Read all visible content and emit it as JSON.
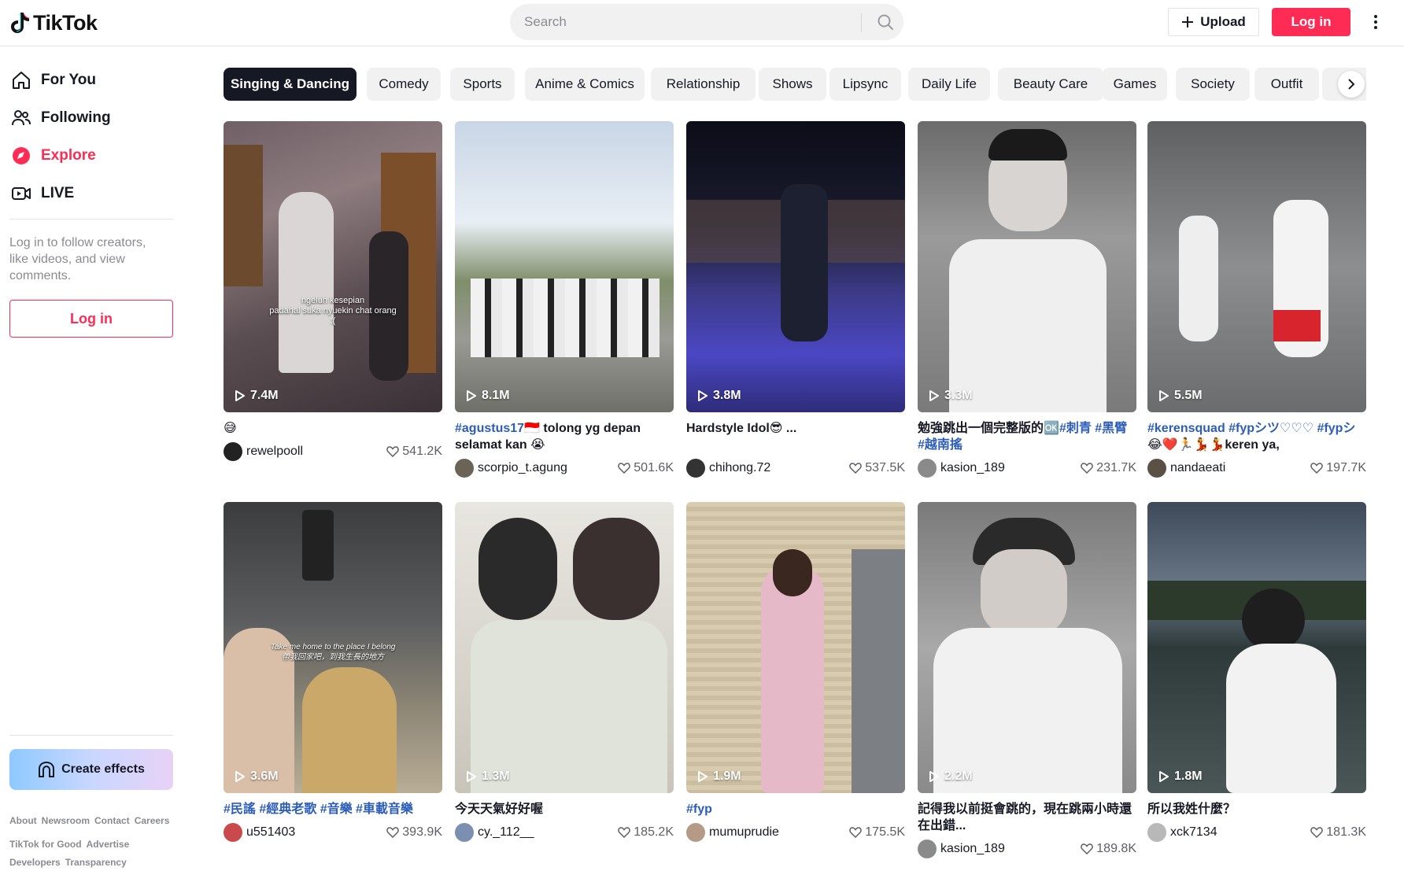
{
  "header": {
    "logo_text": "TikTok",
    "search_placeholder": "Search",
    "upload_label": "Upload",
    "login_label": "Log in"
  },
  "sidebar": {
    "items": [
      {
        "label": "For You",
        "icon": "home-icon"
      },
      {
        "label": "Following",
        "icon": "following-icon"
      },
      {
        "label": "Explore",
        "icon": "compass-icon",
        "active": true
      },
      {
        "label": "LIVE",
        "icon": "live-icon"
      }
    ],
    "note": "Log in to follow creators, like videos, and view comments.",
    "login_label": "Log in",
    "create_effects_label": "Create effects",
    "footer_row1": [
      "About",
      "Newsroom",
      "Contact",
      "Careers"
    ],
    "footer_row2": [
      "TikTok for Good",
      "Advertise"
    ],
    "footer_row3": [
      "Developers",
      "Transparency"
    ]
  },
  "categories": [
    "Singing & Dancing",
    "Comedy",
    "Sports",
    "Anime & Comics",
    "Relationship",
    "Shows",
    "Lipsync",
    "Daily Life",
    "Beauty Care",
    "Games",
    "Society",
    "Outfit",
    "C"
  ],
  "videos": [
    {
      "views": "7.4M",
      "caption": "😅",
      "author": "rewelpooll",
      "likes": "541.2K",
      "overlay": "ngeluh kesepian\npadahal suka nyuekin chat orang\n:("
    },
    {
      "views": "8.1M",
      "caption_tag": "#agustus17",
      "caption": "🇮🇩 tolong yg depan selamat kan 😭",
      "author": "scorpio_t.agung",
      "likes": "501.6K"
    },
    {
      "views": "3.8M",
      "caption": "Hardstyle Idol😎 ...",
      "author": "chihong.72",
      "likes": "537.5K"
    },
    {
      "views": "3.3M",
      "caption": "勉強跳出一個完整版的🆗",
      "caption_tag": "#刺青 #黑臂 #越南搖",
      "author": "kasion_189",
      "likes": "231.7K"
    },
    {
      "views": "5.5M",
      "caption_tag": "#kerensquad #fypシツ♡♡♡ #fypシ",
      "caption": "😂❤️🏃💃💃keren ya,",
      "author": "nandaeati",
      "likes": "197.7K"
    },
    {
      "views": "3.6M",
      "caption_tag": "#民謠 #經典老歌 #音樂 #車載音樂",
      "caption": "",
      "author": "u551403",
      "likes": "393.9K",
      "overlay": "Take me home to the place I belong\n帶我回家吧，到我生長的地方"
    },
    {
      "views": "1.3M",
      "caption": "今天天氣好好喔",
      "author": "cy._112__",
      "likes": "185.2K"
    },
    {
      "views": "1.9M",
      "caption_tag": "#fyp",
      "caption": "",
      "author": "mumuprudie",
      "likes": "175.5K"
    },
    {
      "views": "2.2M",
      "caption": "記得我以前挺會跳的，現在跳兩小時還在出錯...",
      "author": "kasion_189",
      "likes": "189.8K"
    },
    {
      "views": "1.8M",
      "caption": "所以我姓什麼？",
      "author": "xck7134",
      "likes": "181.3K"
    }
  ],
  "colors": {
    "accent": "#fe2c55",
    "tag": "#2b5db9",
    "chip_bg": "#f1f1f2"
  }
}
